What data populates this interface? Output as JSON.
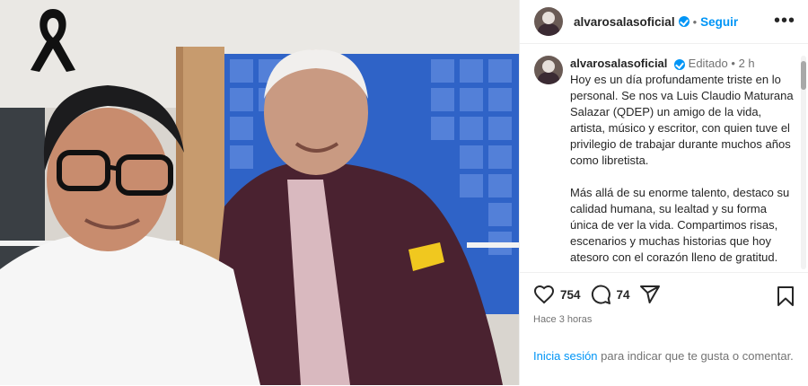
{
  "post": {
    "username": "alvarosalasoficial",
    "follow_label": "Seguir",
    "more_label": "•••",
    "edited_label": "Editado",
    "time_short": "2 h",
    "caption_p1": "Hoy es un día profundamente triste en lo personal. Se nos va Luis Claudio Maturana Salazar (QDEP) un amigo de la vida, artista, músico y escritor, con quien tuve el privilegio de trabajar durante muchos años como libretista.",
    "caption_p2": "Más allá de su enorme talento, destaco su calidad humana, su lealtad y su forma única de ver la vida. Compartimos risas, escenarios y muchas historias que hoy atesoro con el corazón lleno de gratitud.",
    "likes": "754",
    "comments": "74",
    "posted_ago": "Hace 3 horas",
    "login_link": "Inicia sesión",
    "login_text": " para indicar que te gusta o comentar."
  },
  "colors": {
    "accent": "#0095f6",
    "muted": "#737373",
    "text": "#262626"
  },
  "icons": [
    "mourning-ribbon-icon",
    "verified-icon",
    "more-options-icon",
    "heart-icon",
    "comment-icon",
    "share-icon",
    "bookmark-icon"
  ]
}
